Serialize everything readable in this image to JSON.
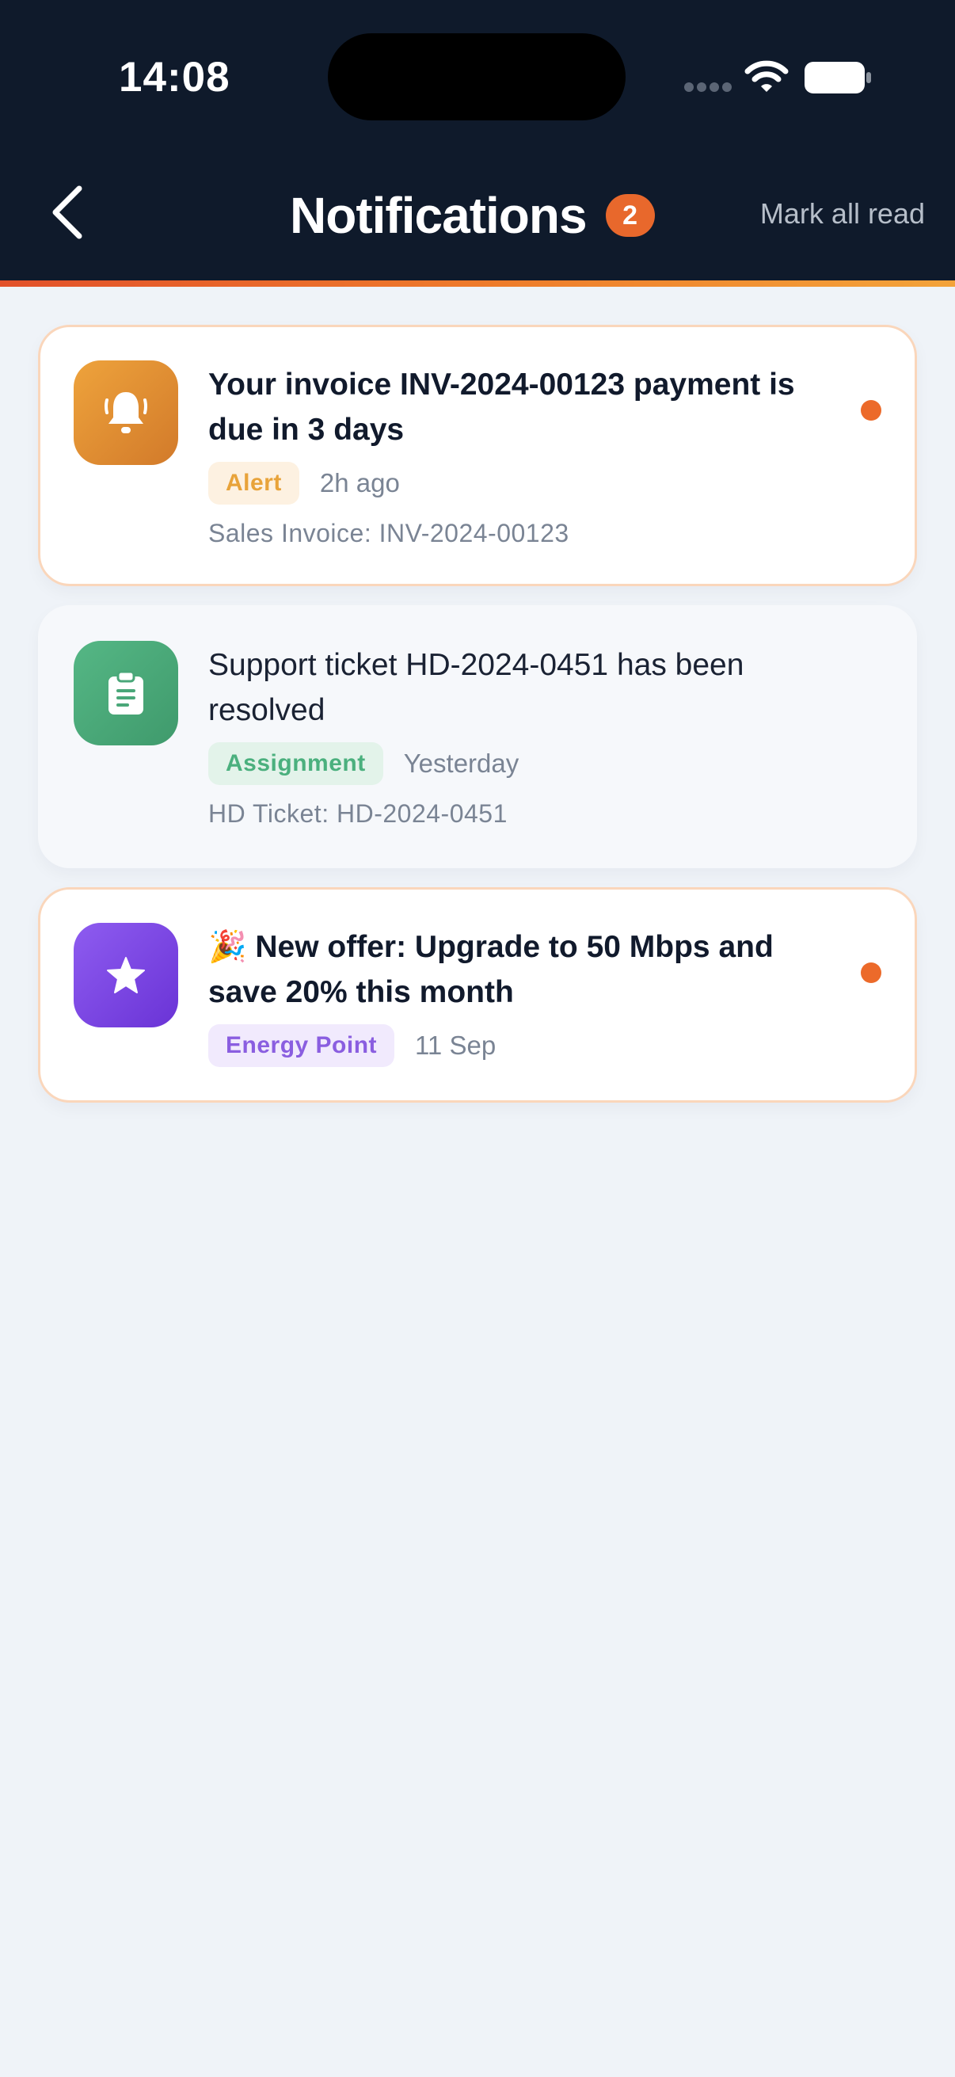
{
  "status_bar": {
    "time": "14:08"
  },
  "header": {
    "back_icon": "chevron-left-icon",
    "title": "Notifications",
    "unread_count": "2",
    "mark_all_label": "Mark all read"
  },
  "colors": {
    "header_bg": "#0f1a2b",
    "accent": "#e8682c",
    "page_bg": "#eff3f8",
    "unread_border": "#fad6bb"
  },
  "notifications": [
    {
      "icon": "bell-icon",
      "icon_color": "#dd8d33",
      "title": "Your invoice INV-2024-00123 payment is due in 3 days",
      "tag": "Alert",
      "tag_text_color": "#e8a33a",
      "tag_bg_color": "#fdf1e1",
      "time": "2h ago",
      "reference": "Sales Invoice: INV-2024-00123",
      "unread": true
    },
    {
      "icon": "clipboard-icon",
      "icon_color": "#4aa779",
      "title": "Support ticket HD-2024-0451 has been resolved",
      "tag": "Assignment",
      "tag_text_color": "#4bb07e",
      "tag_bg_color": "#e3f3ea",
      "time": "Yesterday",
      "reference": "HD Ticket: HD-2024-0451",
      "unread": false
    },
    {
      "icon": "star-icon",
      "icon_color": "#7b46e2",
      "title": "🎉 New offer: Upgrade to 50 Mbps and save 20% this month",
      "tag": "Energy Point",
      "tag_text_color": "#8a5ee0",
      "tag_bg_color": "#f1eafd",
      "time": "11 Sep",
      "reference": "",
      "unread": true
    }
  ]
}
